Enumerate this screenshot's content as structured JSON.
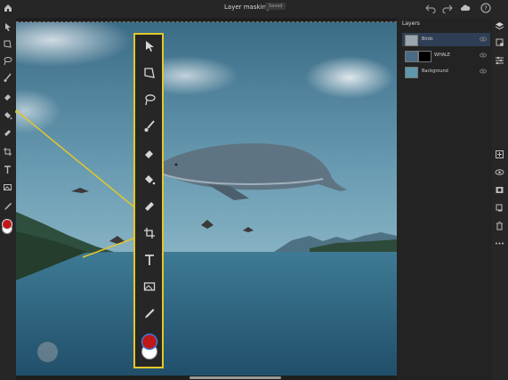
{
  "app": {
    "title": "Layer masking",
    "badge": "Saved",
    "colors": {
      "accent": "#e2c72b",
      "primary_swatch": "#c01818",
      "secondary_swatch": "#ffffff"
    }
  },
  "topbar": {
    "icons": [
      "home-icon",
      "undo-icon",
      "redo-icon",
      "cloud-icon",
      "help-icon"
    ]
  },
  "tools": {
    "items": [
      "select-tool",
      "transform-tool",
      "lasso-tool",
      "brush-tool",
      "eraser-tool",
      "fill-tool",
      "healing-tool",
      "crop-tool",
      "type-tool",
      "place-image-tool",
      "eyedropper-tool"
    ]
  },
  "layers": {
    "title": "Layers",
    "items": [
      {
        "name": "Birds",
        "selected": true
      },
      {
        "name": "WHALE",
        "selected": false
      },
      {
        "name": "Background",
        "selected": false
      }
    ]
  },
  "rightrail": {
    "icons": [
      "layers-icon",
      "layer-properties-icon",
      "adjustments-icon",
      "add-layer-icon",
      "visibility-icon",
      "mask-icon",
      "clip-icon",
      "delete-layer-icon",
      "more-icon"
    ]
  }
}
